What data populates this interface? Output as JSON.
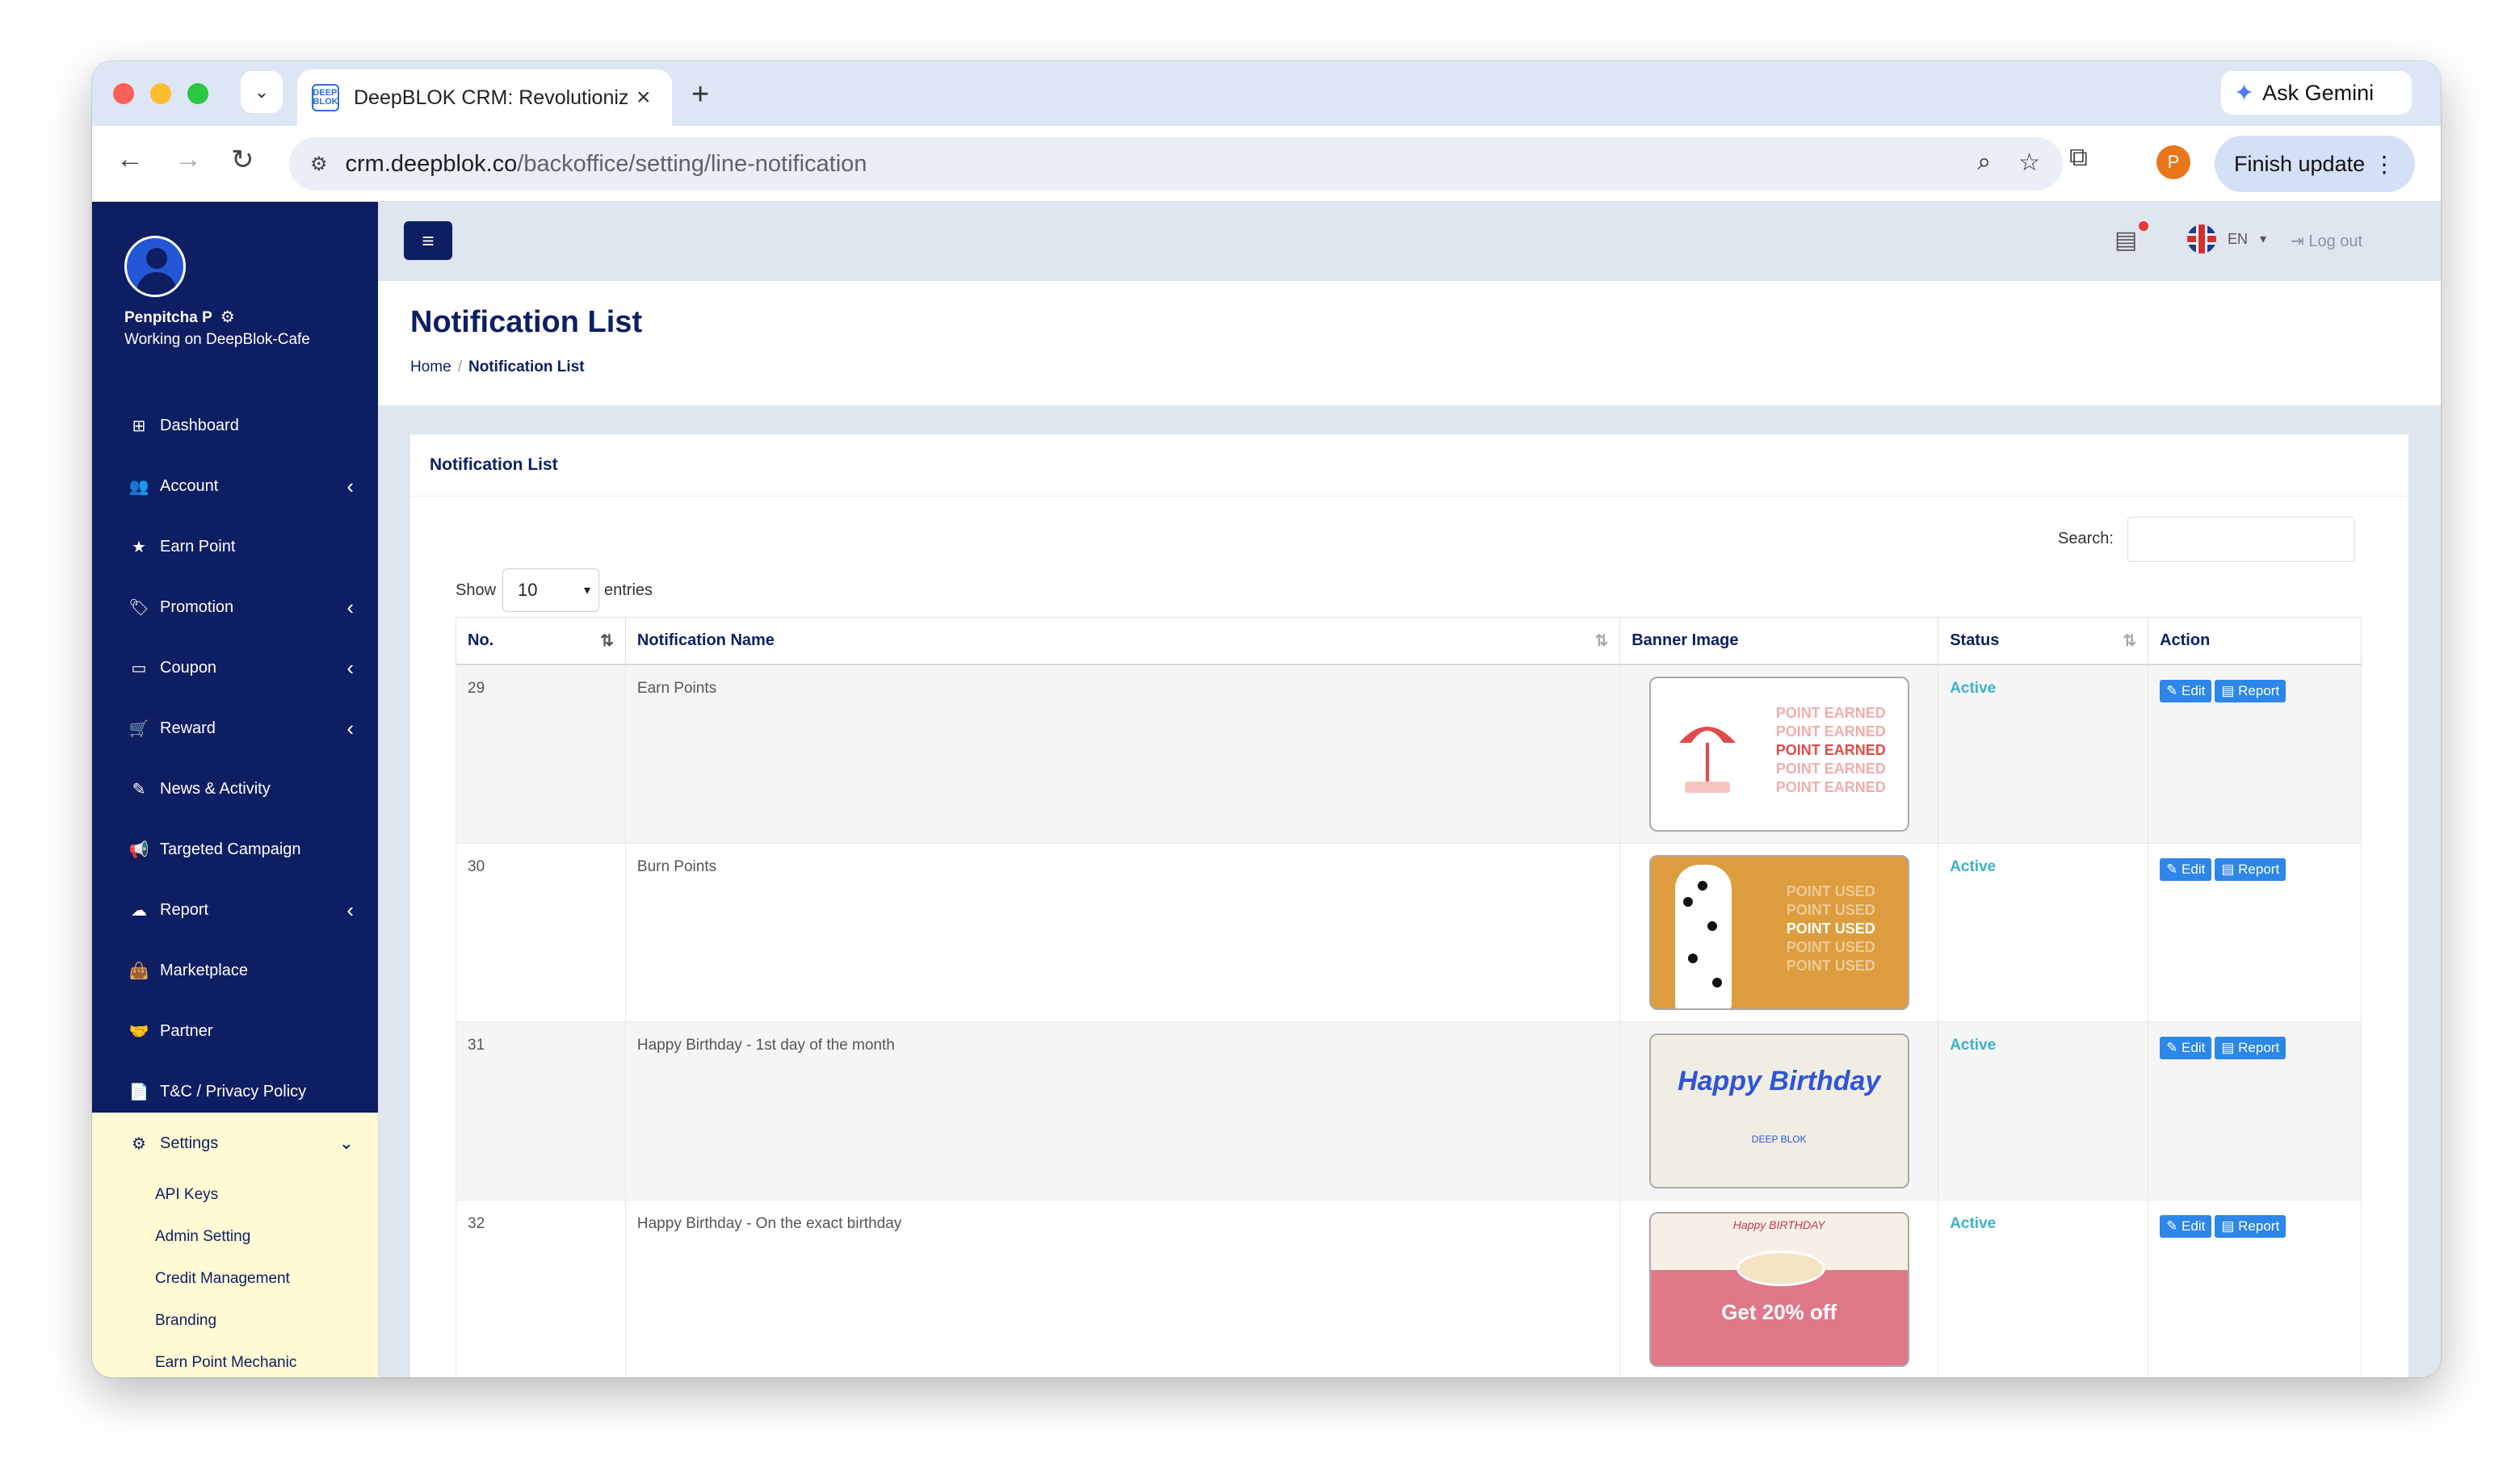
{
  "browser": {
    "tab_title": "DeepBLOK CRM: Revolutioniz",
    "tab_favicon": "DEEP BLOK",
    "url_host": "crm.deepblok.co",
    "url_path": "/backoffice/setting/line-notification",
    "gemini_label": "Ask Gemini",
    "profile_initial": "P",
    "finish_label": "Finish update"
  },
  "sidebar": {
    "user_name": "Penpitcha P",
    "user_work": "Working on DeepBlok-Cafe",
    "items": [
      {
        "label": "Dashboard",
        "icon": "dashboard-icon",
        "glyph": "⊞",
        "chevron": ""
      },
      {
        "label": "Account",
        "icon": "users-icon",
        "glyph": "👥",
        "chevron": "‹"
      },
      {
        "label": "Earn Point",
        "icon": "star-icon",
        "glyph": "★",
        "chevron": ""
      },
      {
        "label": "Promotion",
        "icon": "tag-icon",
        "glyph": "🏷",
        "chevron": "‹"
      },
      {
        "label": "Coupon",
        "icon": "coupon-icon",
        "glyph": "▭",
        "chevron": "‹"
      },
      {
        "label": "Reward",
        "icon": "cart-icon",
        "glyph": "🛒",
        "chevron": "‹"
      },
      {
        "label": "News & Activity",
        "icon": "edit-icon",
        "glyph": "✎",
        "chevron": ""
      },
      {
        "label": "Targeted Campaign",
        "icon": "megaphone-icon",
        "glyph": "📢",
        "chevron": ""
      },
      {
        "label": "Report",
        "icon": "cloud-icon",
        "glyph": "☁",
        "chevron": "‹"
      },
      {
        "label": "Marketplace",
        "icon": "bag-icon",
        "glyph": "👜",
        "chevron": ""
      },
      {
        "label": "Partner",
        "icon": "handshake-icon",
        "glyph": "🤝",
        "chevron": ""
      },
      {
        "label": "T&C / Privacy Policy",
        "icon": "file-icon",
        "glyph": "📄",
        "chevron": ""
      }
    ],
    "settings": {
      "label": "Settings",
      "sub_items": [
        "API Keys",
        "Admin Setting",
        "Credit Management",
        "Branding",
        "Earn Point Mechanic"
      ]
    }
  },
  "topbar": {
    "lang": "EN",
    "logout": "Log out"
  },
  "page": {
    "title": "Notification List",
    "breadcrumb_home": "Home",
    "breadcrumb_current": "Notification List"
  },
  "card": {
    "title": "Notification List",
    "search_label": "Search:",
    "show_label": "Show",
    "entries_value": "10",
    "entries_label": "entries"
  },
  "table": {
    "headers": [
      "No.",
      "Notification Name",
      "Banner Image",
      "Status",
      "Action"
    ],
    "edit_label": "Edit",
    "report_label": "Report",
    "rows": [
      {
        "no": "29",
        "name": "Earn Points",
        "status": "Active"
      },
      {
        "no": "30",
        "name": "Burn Points",
        "status": "Active"
      },
      {
        "no": "31",
        "name": "Happy Birthday - 1st day of the month",
        "status": "Active"
      },
      {
        "no": "32",
        "name": "Happy Birthday - On the exact birthday",
        "status": "Active"
      }
    ]
  },
  "banners": {
    "earned": [
      "POINT EARNED",
      "POINT EARNED",
      "POINT EARNED",
      "POINT EARNED",
      "POINT EARNED"
    ],
    "used": [
      "POINT USED",
      "POINT USED",
      "POINT USED",
      "POINT USED",
      "POINT USED"
    ],
    "birthday_1": "Happy Birthday",
    "birthday_1_logo": "DEEP BLOK",
    "birthday_2_title": "Happy BIRTHDAY",
    "birthday_2_offer": "Get 20% off"
  }
}
